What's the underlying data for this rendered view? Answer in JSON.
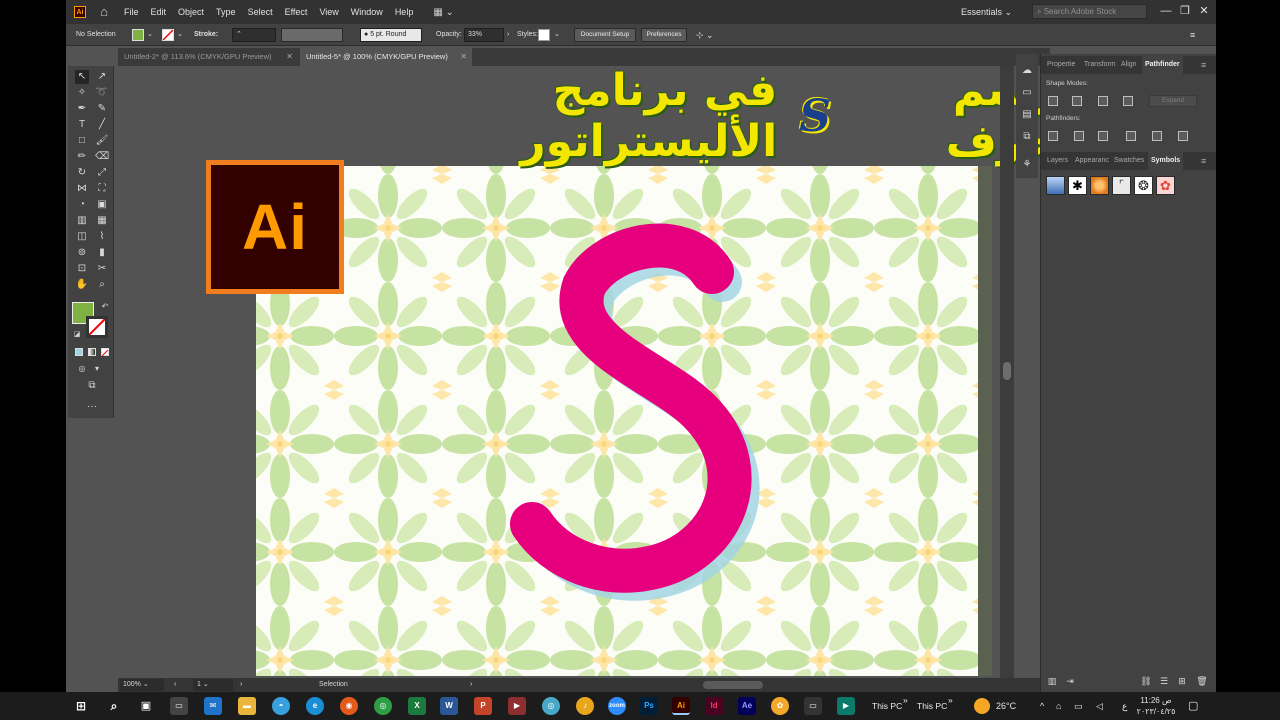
{
  "app": {
    "badge": "Ai",
    "menus": [
      "File",
      "Edit",
      "Object",
      "Type",
      "Select",
      "Effect",
      "View",
      "Window",
      "Help"
    ],
    "workspace": "Essentials",
    "search_placeholder": "Search Adobe Stock"
  },
  "control": {
    "selection": "No Selection",
    "stroke_label": "Stroke:",
    "brush": "5 pt. Round",
    "opacity_label": "Opacity:",
    "opacity_value": "33%",
    "styles_label": "Styles:",
    "document_setup": "Document Setup",
    "preferences": "Preferences"
  },
  "tabs": [
    {
      "label": "Untitled-2* @ 113.6% (CMYK/GPU Preview)",
      "active": false
    },
    {
      "label": "Untitled-5* @ 100% (CMYK/GPU Preview)",
      "active": true
    }
  ],
  "canvas": {
    "headline_right": "رسم حرف",
    "headline_letter": "S",
    "headline_left": "في برنامج الأليستراتور",
    "logo_text": "Ai",
    "big_letter": "S",
    "colors": {
      "magenta": "#e6007e",
      "shadow": "#9fd3e3",
      "logo_bg": "#330000",
      "logo_fg": "#ff9a00",
      "headline": "#f3e600"
    }
  },
  "status": {
    "zoom": "100%",
    "page": "1",
    "tool": "Selection"
  },
  "panels": {
    "top_tabs": [
      "Propertie",
      "Transform",
      "Align",
      "Pathfinder"
    ],
    "active_top": "Pathfinder",
    "shape_modes": "Shape Modes:",
    "pathfinders": "Pathfinders:",
    "expand": "Expand",
    "bottom_tabs": [
      "Layers",
      "Appearanc",
      "Swatches",
      "Symbols"
    ],
    "active_bottom": "Symbols"
  },
  "taskbar": {
    "this_pc_1": "This PC",
    "this_pc_2": "This PC",
    "weather": "26°C",
    "lang": "ع",
    "time": "ص 11:26",
    "date": "٢٠٢٣/٠٤/٢٥",
    "apps": [
      "Ps",
      "Ai",
      "Id",
      "Ae"
    ]
  }
}
